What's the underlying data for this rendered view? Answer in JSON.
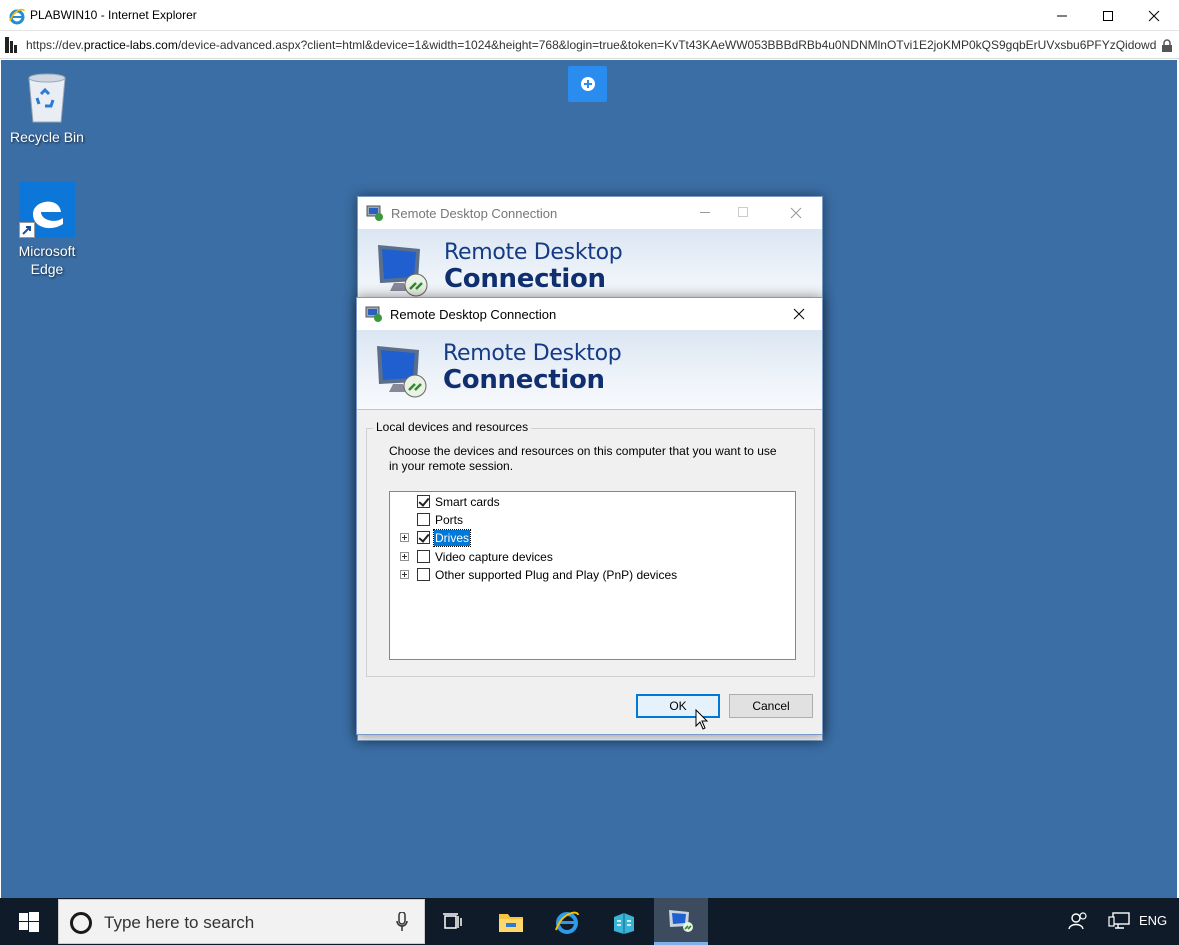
{
  "browser": {
    "window_title": "PLABWIN10 - Internet Explorer",
    "url_prefix": "https://dev.",
    "url_host": "practice-labs.com",
    "url_rest": "/device-advanced.aspx?client=html&device=1&width=1024&height=768&login=true&token=KvTt43KAeWW053BBBdRBb4u0NDNMlnOTvi1E2joKMP0kQS9gqbErUVxsbu6PFYzQidowdX"
  },
  "desktop": {
    "icons": [
      {
        "label": "Recycle Bin",
        "icon": "recycle-bin-icon"
      },
      {
        "label": "Microsoft Edge",
        "icon": "edge-icon"
      }
    ]
  },
  "background_dialog": {
    "title": "Remote Desktop Connection",
    "banner_line1": "Remote Desktop",
    "banner_line2": "Connection"
  },
  "dialog": {
    "title": "Remote Desktop Connection",
    "banner_line1": "Remote Desktop",
    "banner_line2": "Connection",
    "group_label": "Local devices and resources",
    "description": "Choose the devices and resources on this computer that you want to use in your remote session.",
    "items": [
      {
        "label": "Smart cards",
        "checked": true,
        "expandable": false,
        "selected": false
      },
      {
        "label": "Ports",
        "checked": false,
        "expandable": false,
        "selected": false
      },
      {
        "label": "Drives",
        "checked": true,
        "expandable": true,
        "selected": true
      },
      {
        "label": "Video capture devices",
        "checked": false,
        "expandable": true,
        "selected": false
      },
      {
        "label": "Other supported Plug and Play (PnP) devices",
        "checked": false,
        "expandable": true,
        "selected": false
      }
    ],
    "ok_label": "OK",
    "cancel_label": "Cancel"
  },
  "taskbar": {
    "search_placeholder": "Type here to search",
    "tray_language": "ENG"
  },
  "colors": {
    "desktop_bg": "#3b6ea5",
    "taskbar_bg": "#101b2a",
    "accent": "#0078d7"
  }
}
